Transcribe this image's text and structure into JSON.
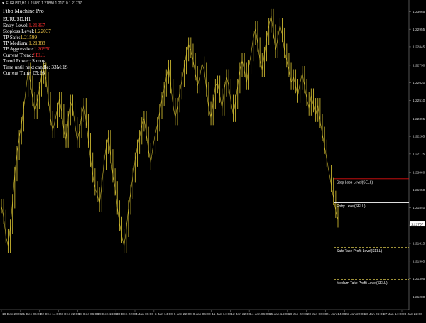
{
  "window": {
    "title": "EURUSD,H1  1.21880  1.21880  1.21710  1.21737"
  },
  "panel": {
    "heading": "Fibo Machine Pro",
    "rows": [
      {
        "label": "EURUSD,H1",
        "value": "",
        "value_color": ""
      },
      {
        "label": "Entry Level:",
        "value": "1.21867",
        "value_color": "#ff3030"
      },
      {
        "label": "Stoploss Level:",
        "value": "1.22037",
        "value_color": "#ffd24a"
      },
      {
        "label": "TP Safe:",
        "value": "1.21599",
        "value_color": "#ffd24a"
      },
      {
        "label": "TP Medium:",
        "value": "1.21388",
        "value_color": "#ffd24a"
      },
      {
        "label": "TP Aggressive:",
        "value": "1.20950",
        "value_color": "#ff3030"
      },
      {
        "label": "Current Trend:",
        "value": "SELL",
        "value_color": "#ff3030"
      },
      {
        "label": "Trend Power: Strong",
        "value": "",
        "value_color": ""
      },
      {
        "label": "Time until next candle: 33M:1S",
        "value": "",
        "value_color": ""
      },
      {
        "label": "Current Time: 05:26",
        "value": "",
        "value_color": ""
      }
    ]
  },
  "levels": [
    {
      "name": "Stop Loss Level(SELL)",
      "price": 1.2202,
      "color": "#e01010",
      "style": "solid"
    },
    {
      "name": "Entry Level(SELL)",
      "price": 1.2187,
      "color": "#ffffff",
      "style": "solid"
    },
    {
      "name": "Safe Take Profit Level(SELL)",
      "price": 1.2159,
      "color": "#d4c24a",
      "style": "dashed"
    },
    {
      "name": "Medium Take Profit Level(SELL)",
      "price": 1.2139,
      "color": "#d4c24a",
      "style": "dashed"
    }
  ],
  "current_price": {
    "label": "1.21737",
    "value": 1.21737
  },
  "chart_data": {
    "type": "line",
    "symbol": "EURUSD,H1",
    "y_ticks": [
      "1.23065",
      "1.22955",
      "1.22845",
      "1.22730",
      "1.22620",
      "1.22510",
      "1.22395",
      "1.22285",
      "1.22175",
      "1.22060",
      "1.21950",
      "1.21840",
      "1.21730",
      "1.21615",
      "1.21505",
      "1.21395",
      "1.21280"
    ],
    "x_ticks": [
      "18 Dec 2020",
      "21 Dec 06:00",
      "22 Dec 14:00",
      "23 Dec 22:00",
      "28 Dec 06:00",
      "29 Dec 14:00",
      "30 Dec 22:00",
      "4 Jan 06:00",
      "5 Jan 14:00",
      "6 Jan 22:00",
      "8 Jan 06:00",
      "11 Jan 14:00",
      "12 Jan 22:00",
      "14 Jan 06:00",
      "15 Jan 14:00",
      "18 Jan 22:00",
      "20 Jan 06:00",
      "21 Jan 14:00",
      "22 Jan 22:00",
      "26 Jan 06:00",
      "27 Jan 14:00",
      "28 Jan 22:00"
    ],
    "ylim": [
      1.2122,
      1.2312
    ],
    "series": [
      {
        "color": "#cbb62f",
        "values": [
          1.2185,
          1.2178,
          1.2166,
          1.216,
          1.2172,
          1.2188,
          1.2205,
          1.2218,
          1.2228,
          1.2236,
          1.2246,
          1.2258,
          1.227,
          1.2262,
          1.2252,
          1.2244,
          1.225,
          1.2258,
          1.2266,
          1.227,
          1.2264,
          1.2252,
          1.224,
          1.2232,
          1.2238,
          1.2245,
          1.2252,
          1.2244,
          1.2232,
          1.2226,
          1.224,
          1.225,
          1.2246,
          1.2236,
          1.2226,
          1.2232,
          1.2242,
          1.2248,
          1.2238,
          1.2226,
          1.2214,
          1.2204,
          1.2196,
          1.2192,
          1.2186,
          1.2198,
          1.2212,
          1.2222,
          1.2228,
          1.2216,
          1.2204,
          1.2196,
          1.2184,
          1.2174,
          1.2166,
          1.216,
          1.217,
          1.2184,
          1.2194,
          1.2204,
          1.2214,
          1.2222,
          1.2228,
          1.2236,
          1.224,
          1.223,
          1.222,
          1.2212,
          1.2222,
          1.223,
          1.2236,
          1.2244,
          1.2252,
          1.2258,
          1.2266,
          1.2272,
          1.226,
          1.2248,
          1.224,
          1.2248,
          1.2256,
          1.2264,
          1.2272,
          1.228,
          1.2286,
          1.2282,
          1.2276,
          1.2268,
          1.226,
          1.2266,
          1.2274,
          1.227,
          1.2258,
          1.2246,
          1.224,
          1.225,
          1.226,
          1.2262,
          1.2254,
          1.2246,
          1.2258,
          1.2266,
          1.226,
          1.225,
          1.2242,
          1.225,
          1.226,
          1.227,
          1.2276,
          1.227,
          1.2262,
          1.2272,
          1.228,
          1.229,
          1.2296,
          1.2286,
          1.2276,
          1.227,
          1.228,
          1.229,
          1.2298,
          1.2304,
          1.2294,
          1.2282,
          1.229,
          1.2298,
          1.2292,
          1.2282,
          1.2276,
          1.227,
          1.2262,
          1.2266,
          1.226,
          1.2254,
          1.2262,
          1.2268,
          1.226,
          1.2252,
          1.2246,
          1.2254,
          1.2248,
          1.2242,
          1.2248,
          1.2238,
          1.223,
          1.2222,
          1.2214,
          1.2206,
          1.2198,
          1.219,
          1.2182,
          1.2176
        ]
      }
    ]
  }
}
